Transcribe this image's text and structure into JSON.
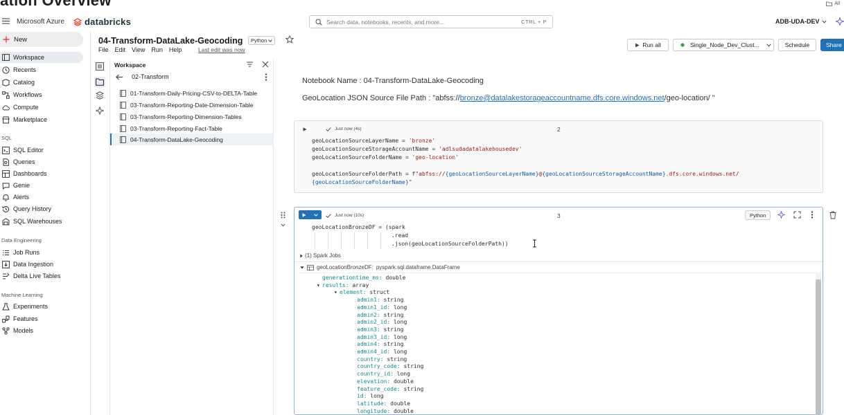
{
  "overlay": {
    "title": "ation Overview",
    "right_label": "All"
  },
  "topbar": {
    "brand_left": "Microsoft Azure",
    "brand": "databricks",
    "search_placeholder": "Search data, notebooks, recents, and more...",
    "search_shortcut": "CTRL + P",
    "workspace": "ADB-UDA-DEV"
  },
  "leftnav": {
    "new_label": "New",
    "main_items": [
      {
        "label": "Workspace",
        "icon": "folder-icon",
        "active": true
      },
      {
        "label": "Recents",
        "icon": "clock-icon"
      },
      {
        "label": "Catalog",
        "icon": "catalog-icon"
      },
      {
        "label": "Workflows",
        "icon": "workflows-icon"
      },
      {
        "label": "Compute",
        "icon": "cloud-icon"
      },
      {
        "label": "Marketplace",
        "icon": "store-icon"
      }
    ],
    "sql_heading": "SQL",
    "sql_items": [
      {
        "label": "SQL Editor",
        "icon": "sql-editor-icon"
      },
      {
        "label": "Queries",
        "icon": "queries-icon"
      },
      {
        "label": "Dashboards",
        "icon": "dashboard-icon"
      },
      {
        "label": "Genie",
        "icon": "genie-icon"
      },
      {
        "label": "Alerts",
        "icon": "bell-icon"
      },
      {
        "label": "Query History",
        "icon": "history-icon"
      },
      {
        "label": "SQL Warehouses",
        "icon": "warehouse-icon"
      }
    ],
    "de_heading": "Data Engineering",
    "de_items": [
      {
        "label": "Job Runs",
        "icon": "job-runs-icon"
      },
      {
        "label": "Data Ingestion",
        "icon": "ingestion-icon"
      },
      {
        "label": "Delta Live Tables",
        "icon": "dlt-icon"
      }
    ],
    "ml_heading": "Machine Learning",
    "ml_items": [
      {
        "label": "Experiments",
        "icon": "flask-icon"
      },
      {
        "label": "Features",
        "icon": "features-icon"
      },
      {
        "label": "Models",
        "icon": "models-icon"
      }
    ]
  },
  "notebook": {
    "title": "04-Transform-DataLake-Geocoding",
    "language": "Python",
    "menu": [
      "File",
      "Edit",
      "View",
      "Run",
      "Help"
    ],
    "last_edit": "Last edit was now",
    "run_all": "Run all",
    "cluster": "Single_Node_Dev_Clust...",
    "schedule": "Schedule",
    "share": "Share"
  },
  "browser": {
    "heading": "Workspace",
    "folder": "02-Transform",
    "items": [
      {
        "label": "01-Transform-Daily-Pricing-CSV-to-DELTA-Table"
      },
      {
        "label": "03-Transform-Reporting-Date-Dimension-Table"
      },
      {
        "label": "03-Transform-Reporting-Dimension-Tables"
      },
      {
        "label": "03-Transform-Reporting-Fact-Table"
      },
      {
        "label": "04-Transform-DataLake-Geocoding",
        "active": true
      }
    ]
  },
  "markdown": {
    "line1": "Notebook Name : 04-Transform-DataLake-Geocoding",
    "line2_prefix": "GeoLocation JSON Source File Path : \"abfss://",
    "line2_link": "bronze@datalakestorageaccountname.dfs.core.windows.net",
    "line2_suffix": "/geo-location/ \""
  },
  "cell2": {
    "status": "Just now (4s)",
    "number": "2",
    "l1_var": "geoLocationSourceLayerName = ",
    "l1_val": "'bronze'",
    "l2_var": "geoLocationSourceStorageAccountName = ",
    "l2_val": "'adlsudadatalakehousedev'",
    "l3_var": "geoLocationSourceFolderName = ",
    "l3_val": "'geo-location'",
    "l4_var": "geoLocationSourceFolderPath = f",
    "l4_s1": "\"abfss://",
    "l4_e1": "{geoLocationSourceLayerName}",
    "l4_s2": "@",
    "l4_e2": "{geoLocationSourceStorageAccountName}",
    "l4_s3": ".dfs.core.windows.net/",
    "l5_e": "{geoLocationSourceFolderName}",
    "l5_s": "\""
  },
  "cell3": {
    "status": "Just now (10s)",
    "number": "3",
    "language": "Python",
    "code_l1": "geoLocationBronzeDF = (spark",
    "code_l2": ".read",
    "code_l3": ".json(geoLocationSourceFolderPath))",
    "spark_jobs": "(1) Spark Jobs",
    "df_name": "geoLocationBronzeDF:",
    "df_type": "pyspark.sql.dataframe.DataFrame",
    "schema": [
      {
        "name": "generationtime_ms:",
        "type": "double",
        "level": 0
      },
      {
        "name": "results:",
        "type": "array",
        "level": 0,
        "caret": true
      },
      {
        "name": "element:",
        "type": "struct",
        "level": 1,
        "caret": true
      },
      {
        "name": "admin1:",
        "type": "string",
        "level": 2
      },
      {
        "name": "admin1_id:",
        "type": "long",
        "level": 2
      },
      {
        "name": "admin2:",
        "type": "string",
        "level": 2
      },
      {
        "name": "admin2_id:",
        "type": "long",
        "level": 2
      },
      {
        "name": "admin3:",
        "type": "string",
        "level": 2
      },
      {
        "name": "admin3_id:",
        "type": "long",
        "level": 2
      },
      {
        "name": "admin4:",
        "type": "string",
        "level": 2
      },
      {
        "name": "admin4_id:",
        "type": "long",
        "level": 2
      },
      {
        "name": "country:",
        "type": "string",
        "level": 2
      },
      {
        "name": "country_code:",
        "type": "string",
        "level": 2
      },
      {
        "name": "country_id:",
        "type": "long",
        "level": 2
      },
      {
        "name": "elevation:",
        "type": "double",
        "level": 2
      },
      {
        "name": "feature_code:",
        "type": "string",
        "level": 2
      },
      {
        "name": "id:",
        "type": "long",
        "level": 2
      },
      {
        "name": "latitude:",
        "type": "double",
        "level": 2
      },
      {
        "name": "longitude:",
        "type": "double",
        "level": 2
      }
    ]
  },
  "colors": {
    "accent": "#2272b4",
    "link": "#2272b4",
    "string": "#a31515",
    "field": "#138a8a",
    "brand_red": "#ff3621"
  }
}
